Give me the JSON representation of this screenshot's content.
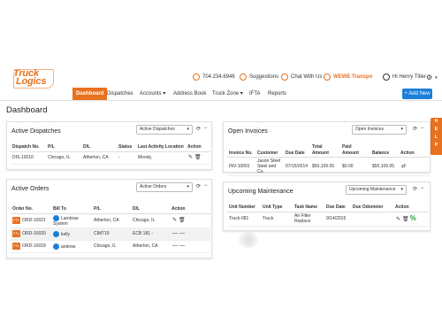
{
  "header": {
    "logo_top": "Truck",
    "logo_bottom": "Logics",
    "phone": "704.234.6946",
    "suggestions": "Suggestions",
    "chat": "Chat With Us",
    "transport": "WEWE Transpo",
    "user": "Hi Henry Titler",
    "settings_caret": "▾"
  },
  "nav": {
    "items": [
      "Dashboard",
      "Dispatches",
      "Accounts ▾",
      "Address Book",
      "Truck Zone ▾",
      "IFTA",
      "Reports"
    ],
    "add_new": "+ Add New"
  },
  "side_tab": [
    "H",
    "E",
    "L",
    "P"
  ],
  "page": {
    "title": "Dashboard"
  },
  "active_dispatches": {
    "title": "Active Dispatches",
    "select": "Active Dispatches",
    "columns": [
      "Dispatch No.",
      "P/L",
      "D/L",
      "Status",
      "Last Activity Location",
      "Action"
    ],
    "rows": [
      [
        "DIS-10010",
        "Chicago, IL",
        "Atherton, CA",
        "-",
        "Moody,",
        ""
      ]
    ]
  },
  "active_orders": {
    "title": "Active Orders",
    "select": "Active Orders",
    "columns": [
      "Order No.",
      "Bill To",
      "P/L",
      "D/L",
      "Action"
    ],
    "rows": [
      {
        "tag": "FTL",
        "order": "ORD-10021",
        "bill_to": "Lambrae System",
        "pl": "Atherton, CA",
        "dl": "Chicago, IL"
      },
      {
        "tag": "FTL",
        "order": "ORD-10020",
        "bill_to": "kelly",
        "pl": "CIM719",
        "dl": "ECB 181 -"
      },
      {
        "tag": "FTL",
        "order": "ORD-10018",
        "bill_to": "andrew",
        "pl": "Chicago, IL",
        "dl": "Atherton, CA"
      }
    ]
  },
  "open_invoices": {
    "title": "Open Invoices",
    "select": "Open Invoices",
    "columns": [
      "Invoice No.",
      "Customer",
      "Due Date",
      "Total Amount",
      "Paid Amount",
      "Balance",
      "Action"
    ],
    "rows": [
      [
        "INV-10001",
        "Jason Steel Steel and Co.",
        "07/15/2014",
        "$50,109.05",
        "$0.00",
        "$50,109.05",
        ""
      ]
    ]
  },
  "upcoming_maintenance": {
    "title": "Upcoming Maintenance",
    "select": "Upcoming Maintenance",
    "columns": [
      "Unit Number",
      "Unit Type",
      "Task Name",
      "Due Date",
      "Due Odometer",
      "Action"
    ],
    "rows": [
      [
        "Truck-081",
        "Truck",
        "Air Filter Replace",
        "9/14/2015",
        "",
        ""
      ]
    ]
  },
  "colors": {
    "accent": "#e8711f",
    "primary": "#1b7fd8"
  }
}
